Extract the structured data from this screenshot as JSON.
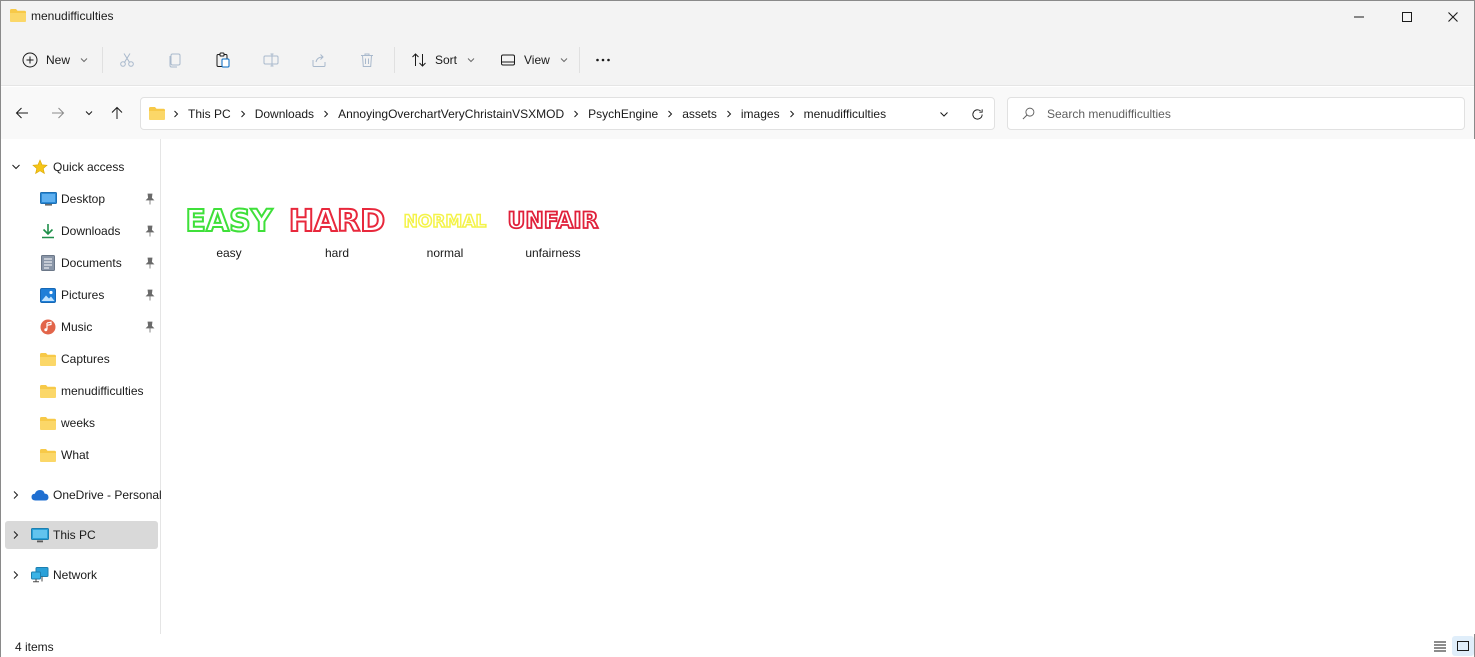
{
  "window": {
    "title": "menudifficulties",
    "minimize_icon": "minimize-icon",
    "maximize_icon": "maximize-icon",
    "close_icon": "close-icon"
  },
  "toolbar": {
    "new_label": "New",
    "sort_label": "Sort",
    "view_label": "View",
    "actions": [
      "cut-icon",
      "copy-icon",
      "paste-icon",
      "rename-icon",
      "share-icon",
      "delete-icon"
    ]
  },
  "navigation": {
    "breadcrumbs": [
      "This PC",
      "Downloads",
      "AnnoyingOverchartVeryChristainVSXMOD",
      "PsychEngine",
      "assets",
      "images",
      "menudifficulties"
    ],
    "search_placeholder": "Search menudifficulties"
  },
  "sidebar": {
    "quick_access_label": "Quick access",
    "items": [
      {
        "label": "Desktop",
        "icon": "desktop-icon",
        "pinned": true
      },
      {
        "label": "Downloads",
        "icon": "download-icon",
        "pinned": true
      },
      {
        "label": "Documents",
        "icon": "documents-icon",
        "pinned": true
      },
      {
        "label": "Pictures",
        "icon": "pictures-icon",
        "pinned": true
      },
      {
        "label": "Music",
        "icon": "music-icon",
        "pinned": true
      },
      {
        "label": "Captures",
        "icon": "folder-icon",
        "pinned": false
      },
      {
        "label": "menudifficulties",
        "icon": "folder-icon",
        "pinned": false
      },
      {
        "label": "weeks",
        "icon": "folder-icon",
        "pinned": false
      },
      {
        "label": "What",
        "icon": "folder-icon",
        "pinned": false
      }
    ],
    "onedrive_label": "OneDrive - Personal",
    "thispc_label": "This PC",
    "network_label": "Network"
  },
  "files": [
    {
      "name": "easy",
      "thumb_text": "EASY",
      "color": "#3fe03a"
    },
    {
      "name": "hard",
      "thumb_text": "HARD",
      "color": "#e8283c"
    },
    {
      "name": "normal",
      "thumb_text": "NORMAL",
      "color": "#f4f34a"
    },
    {
      "name": "unfairness",
      "thumb_text": "UNFAIR",
      "color": "#e0203a"
    }
  ],
  "status": {
    "item_count": "4 items"
  },
  "colors": {
    "accent": "#0067c0",
    "folder": "#f7c948"
  }
}
